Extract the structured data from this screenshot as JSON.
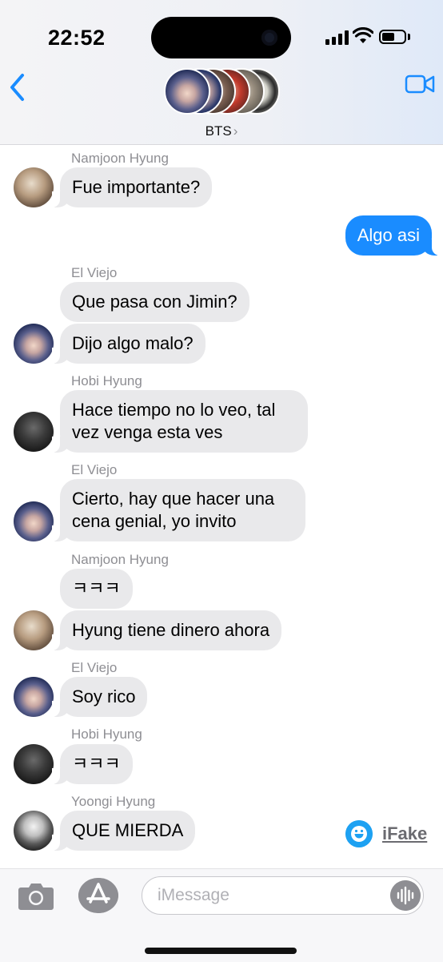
{
  "status_bar": {
    "time": "22:52"
  },
  "header": {
    "group_name": "BTS",
    "chevron": "›"
  },
  "messages": [
    {
      "sender": "Namjoon Hyung",
      "text": "Fue importante?"
    },
    {
      "text": "Algo asi"
    },
    {
      "sender": "El Viejo",
      "text": "Que pasa con Jimin?"
    },
    {
      "text": "Dijo algo malo?"
    },
    {
      "sender": "Hobi Hyung",
      "line1": "Hace tiempo no lo veo, tal",
      "line2": "vez venga esta ves"
    },
    {
      "sender": "El Viejo",
      "line1": "Cierto, hay que hacer una",
      "line2": "cena genial, yo invito"
    },
    {
      "sender": "Namjoon Hyung",
      "text": "ㅋㅋㅋ"
    },
    {
      "text": "Hyung tiene dinero ahora"
    },
    {
      "sender": "El Viejo",
      "text": "Soy rico"
    },
    {
      "sender": "Hobi Hyung",
      "text": "ㅋㅋㅋ"
    },
    {
      "sender": "Yoongi Hyung",
      "text": "QUE MIERDA"
    }
  ],
  "watermark": {
    "label": "iFake"
  },
  "composer": {
    "placeholder": "iMessage"
  },
  "colors": {
    "accent": "#1a8cff",
    "incoming_bubble": "#e9e9eb",
    "outgoing_bubble": "#1a8cff"
  },
  "icons": [
    "back-chevron-icon",
    "video-call-icon",
    "camera-icon",
    "app-store-icon",
    "audio-waveform-icon"
  ]
}
